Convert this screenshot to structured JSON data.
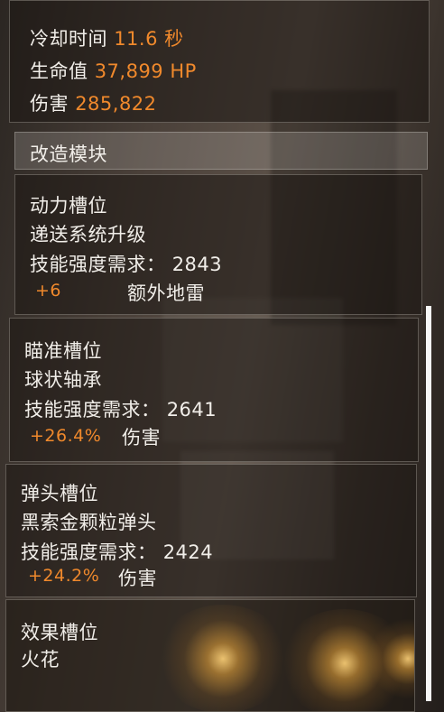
{
  "stats": {
    "cooldown_label": "冷却时间",
    "cooldown_value": "11.6 秒",
    "health_label": "生命值",
    "health_value": "37,899 HP",
    "damage_label": "伤害",
    "damage_value": "285,822"
  },
  "mods_header": "改造模块",
  "slots": [
    {
      "slot_name": "动力槽位",
      "mod_name": "递送系统升级",
      "requirement_label": "技能强度需求：",
      "requirement_value": "2843",
      "bonus_value": "+6",
      "bonus_label": "额外地雷"
    },
    {
      "slot_name": "瞄准槽位",
      "mod_name": "球状轴承",
      "requirement_label": "技能强度需求：",
      "requirement_value": "2641",
      "bonus_value": "+26.4%",
      "bonus_label": "伤害"
    },
    {
      "slot_name": "弹头槽位",
      "mod_name": "黑索金颗粒弹头",
      "requirement_label": "技能强度需求：",
      "requirement_value": "2424",
      "bonus_value": "+24.2%",
      "bonus_label": "伤害"
    },
    {
      "slot_name": "效果槽位",
      "mod_name": "火花"
    }
  ],
  "colors": {
    "accent": "#f0892c",
    "text": "#f1eee9"
  }
}
